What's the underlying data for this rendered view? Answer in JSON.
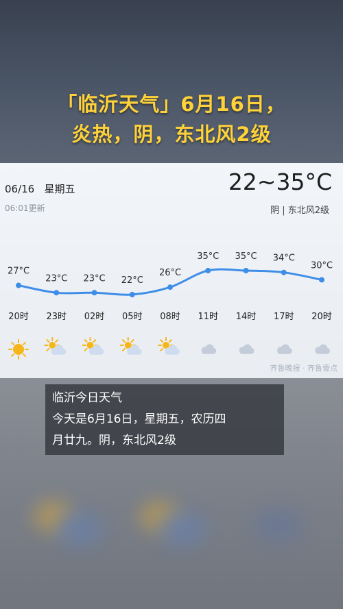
{
  "headline": {
    "line1": "「临沂天气」6月16日，",
    "line2": "炎热，阴，东北风2级"
  },
  "card": {
    "date": "06/16",
    "weekday": "星期五",
    "updated": "06:01更新",
    "temp_range": "22~35°C",
    "condition": "阴 | 东北风2级",
    "watermark": "齐鲁晚报 · 齐鲁壹点"
  },
  "hourly": [
    {
      "time": "20时",
      "temp": "27°C",
      "value": 27,
      "icon": "sun-icon"
    },
    {
      "time": "23时",
      "temp": "23°C",
      "value": 23,
      "icon": "partly-cloudy-icon"
    },
    {
      "time": "02时",
      "temp": "23°C",
      "value": 23,
      "icon": "partly-cloudy-icon"
    },
    {
      "time": "05时",
      "temp": "22°C",
      "value": 22,
      "icon": "partly-cloudy-icon"
    },
    {
      "time": "08时",
      "temp": "26°C",
      "value": 26,
      "icon": "partly-cloudy-icon"
    },
    {
      "time": "11时",
      "temp": "35°C",
      "value": 35,
      "icon": "cloud-icon"
    },
    {
      "time": "14时",
      "temp": "35°C",
      "value": 35,
      "icon": "cloud-icon"
    },
    {
      "time": "17时",
      "temp": "34°C",
      "value": 34,
      "icon": "cloud-icon"
    },
    {
      "time": "20时",
      "temp": "30°C",
      "value": 30,
      "icon": "cloud-icon"
    }
  ],
  "colors": {
    "line": "#3e8ee8",
    "headline": "#ffd23a",
    "sun": "#f6b619"
  },
  "caption": {
    "line1": "临沂今日天气",
    "line2": "今天是6月16日，星期五，农历四",
    "line3": "月廿九。阴，东北风2级"
  }
}
